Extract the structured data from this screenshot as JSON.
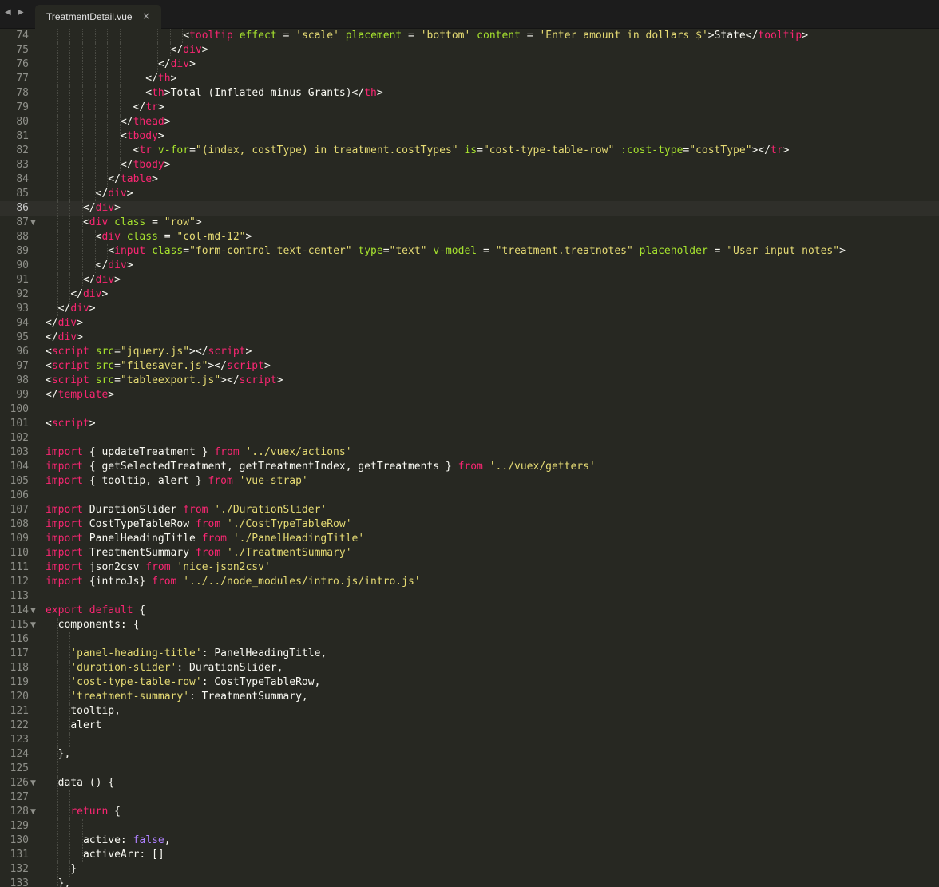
{
  "tabbar": {
    "nav_back": "◀",
    "nav_forward": "▶",
    "tab_title": "TreatmentDetail.vue",
    "tab_close": "×"
  },
  "editor": {
    "current_line": 86,
    "lines": [
      {
        "n": "74",
        "indent": 11,
        "tokens": [
          [
            "p",
            "<"
          ],
          [
            "k",
            "tooltip"
          ],
          [
            "p",
            " "
          ],
          [
            "a",
            "effect"
          ],
          [
            "p",
            " = "
          ],
          [
            "s",
            "'scale'"
          ],
          [
            "p",
            " "
          ],
          [
            "a",
            "placement"
          ],
          [
            "p",
            " = "
          ],
          [
            "s",
            "'bottom'"
          ],
          [
            "p",
            " "
          ],
          [
            "a",
            "content"
          ],
          [
            "p",
            " = "
          ],
          [
            "s",
            "'Enter amount in dollars $'"
          ],
          [
            "p",
            ">State</"
          ],
          [
            "k",
            "tooltip"
          ],
          [
            "p",
            ">"
          ]
        ]
      },
      {
        "n": "75",
        "indent": 10,
        "tokens": [
          [
            "p",
            "</"
          ],
          [
            "k",
            "div"
          ],
          [
            "p",
            ">"
          ]
        ]
      },
      {
        "n": "76",
        "indent": 9,
        "tokens": [
          [
            "p",
            "</"
          ],
          [
            "k",
            "div"
          ],
          [
            "p",
            ">"
          ]
        ]
      },
      {
        "n": "77",
        "indent": 8,
        "tokens": [
          [
            "p",
            "</"
          ],
          [
            "k",
            "th"
          ],
          [
            "p",
            ">"
          ]
        ]
      },
      {
        "n": "78",
        "indent": 8,
        "tokens": [
          [
            "p",
            "<"
          ],
          [
            "k",
            "th"
          ],
          [
            "p",
            ">Total (Inflated minus Grants)</"
          ],
          [
            "k",
            "th"
          ],
          [
            "p",
            ">"
          ]
        ]
      },
      {
        "n": "79",
        "indent": 7,
        "tokens": [
          [
            "p",
            "</"
          ],
          [
            "k",
            "tr"
          ],
          [
            "p",
            ">"
          ]
        ]
      },
      {
        "n": "80",
        "indent": 6,
        "tokens": [
          [
            "p",
            "</"
          ],
          [
            "k",
            "thead"
          ],
          [
            "p",
            ">"
          ]
        ]
      },
      {
        "n": "81",
        "indent": 6,
        "tokens": [
          [
            "p",
            "<"
          ],
          [
            "k",
            "tbody"
          ],
          [
            "p",
            ">"
          ]
        ]
      },
      {
        "n": "82",
        "indent": 7,
        "tokens": [
          [
            "p",
            "<"
          ],
          [
            "k",
            "tr"
          ],
          [
            "p",
            " "
          ],
          [
            "a",
            "v-for"
          ],
          [
            "p",
            "="
          ],
          [
            "s",
            "\"(index, costType) in treatment.costTypes\""
          ],
          [
            "p",
            " "
          ],
          [
            "a",
            "is"
          ],
          [
            "p",
            "="
          ],
          [
            "s",
            "\"cost-type-table-row\""
          ],
          [
            "p",
            " "
          ],
          [
            "a",
            ":cost-type"
          ],
          [
            "p",
            "="
          ],
          [
            "s",
            "\"costType\""
          ],
          [
            "p",
            "></"
          ],
          [
            "k",
            "tr"
          ],
          [
            "p",
            ">"
          ]
        ]
      },
      {
        "n": "83",
        "indent": 6,
        "tokens": [
          [
            "p",
            "</"
          ],
          [
            "k",
            "tbody"
          ],
          [
            "p",
            ">"
          ]
        ]
      },
      {
        "n": "84",
        "indent": 5,
        "tokens": [
          [
            "p",
            "</"
          ],
          [
            "k",
            "table"
          ],
          [
            "p",
            ">"
          ]
        ]
      },
      {
        "n": "85",
        "indent": 4,
        "tokens": [
          [
            "p",
            "</"
          ],
          [
            "k",
            "div"
          ],
          [
            "p",
            ">"
          ]
        ]
      },
      {
        "n": "86",
        "indent": 3,
        "tokens": [
          [
            "p",
            "</"
          ],
          [
            "k",
            "div"
          ],
          [
            "p",
            ">"
          ]
        ]
      },
      {
        "n": "87",
        "indent": 3,
        "fold": true,
        "tokens": [
          [
            "p",
            "<"
          ],
          [
            "k",
            "div"
          ],
          [
            "p",
            " "
          ],
          [
            "a",
            "class"
          ],
          [
            "p",
            " = "
          ],
          [
            "s",
            "\"row\""
          ],
          [
            "p",
            ">"
          ]
        ]
      },
      {
        "n": "88",
        "indent": 4,
        "tokens": [
          [
            "p",
            "<"
          ],
          [
            "k",
            "div"
          ],
          [
            "p",
            " "
          ],
          [
            "a",
            "class"
          ],
          [
            "p",
            " = "
          ],
          [
            "s",
            "\"col-md-12\""
          ],
          [
            "p",
            ">"
          ]
        ]
      },
      {
        "n": "89",
        "indent": 5,
        "tokens": [
          [
            "p",
            "<"
          ],
          [
            "k",
            "input"
          ],
          [
            "p",
            " "
          ],
          [
            "a",
            "class"
          ],
          [
            "p",
            "="
          ],
          [
            "s",
            "\"form-control text-center\""
          ],
          [
            "p",
            " "
          ],
          [
            "a",
            "type"
          ],
          [
            "p",
            "="
          ],
          [
            "s",
            "\"text\""
          ],
          [
            "p",
            " "
          ],
          [
            "a",
            "v-model"
          ],
          [
            "p",
            " = "
          ],
          [
            "s",
            "\"treatment.treatnotes\""
          ],
          [
            "p",
            " "
          ],
          [
            "a",
            "placeholder"
          ],
          [
            "p",
            " = "
          ],
          [
            "s",
            "\"User input notes\""
          ],
          [
            "p",
            ">"
          ]
        ]
      },
      {
        "n": "90",
        "indent": 4,
        "tokens": [
          [
            "p",
            "</"
          ],
          [
            "k",
            "div"
          ],
          [
            "p",
            ">"
          ]
        ]
      },
      {
        "n": "91",
        "indent": 3,
        "tokens": [
          [
            "p",
            "</"
          ],
          [
            "k",
            "div"
          ],
          [
            "p",
            ">"
          ]
        ]
      },
      {
        "n": "92",
        "indent": 2,
        "tokens": [
          [
            "p",
            "</"
          ],
          [
            "k",
            "div"
          ],
          [
            "p",
            ">"
          ]
        ]
      },
      {
        "n": "93",
        "indent": 1,
        "tokens": [
          [
            "p",
            "</"
          ],
          [
            "k",
            "div"
          ],
          [
            "p",
            ">"
          ]
        ]
      },
      {
        "n": "94",
        "indent": 0,
        "tokens": [
          [
            "p",
            "</"
          ],
          [
            "k",
            "div"
          ],
          [
            "p",
            ">"
          ]
        ]
      },
      {
        "n": "95",
        "indent": 0,
        "tokens": [
          [
            "p",
            "</"
          ],
          [
            "k",
            "div"
          ],
          [
            "p",
            ">"
          ]
        ]
      },
      {
        "n": "96",
        "indent": 0,
        "tokens": [
          [
            "p",
            "<"
          ],
          [
            "k",
            "script"
          ],
          [
            "p",
            " "
          ],
          [
            "a",
            "src"
          ],
          [
            "p",
            "="
          ],
          [
            "s",
            "\"jquery.js\""
          ],
          [
            "p",
            "></"
          ],
          [
            "k",
            "script"
          ],
          [
            "p",
            ">"
          ]
        ]
      },
      {
        "n": "97",
        "indent": 0,
        "tokens": [
          [
            "p",
            "<"
          ],
          [
            "k",
            "script"
          ],
          [
            "p",
            " "
          ],
          [
            "a",
            "src"
          ],
          [
            "p",
            "="
          ],
          [
            "s",
            "\"filesaver.js\""
          ],
          [
            "p",
            "></"
          ],
          [
            "k",
            "script"
          ],
          [
            "p",
            ">"
          ]
        ]
      },
      {
        "n": "98",
        "indent": 0,
        "tokens": [
          [
            "p",
            "<"
          ],
          [
            "k",
            "script"
          ],
          [
            "p",
            " "
          ],
          [
            "a",
            "src"
          ],
          [
            "p",
            "="
          ],
          [
            "s",
            "\"tableexport.js\""
          ],
          [
            "p",
            "></"
          ],
          [
            "k",
            "script"
          ],
          [
            "p",
            ">"
          ]
        ]
      },
      {
        "n": "99",
        "indent": 0,
        "tokens": [
          [
            "p",
            "</"
          ],
          [
            "k",
            "template"
          ],
          [
            "p",
            ">"
          ]
        ]
      },
      {
        "n": "100",
        "indent": 0,
        "tokens": []
      },
      {
        "n": "101",
        "indent": 0,
        "tokens": [
          [
            "p",
            "<"
          ],
          [
            "k",
            "script"
          ],
          [
            "p",
            ">"
          ]
        ]
      },
      {
        "n": "102",
        "indent": 0,
        "tokens": []
      },
      {
        "n": "103",
        "indent": 0,
        "tokens": [
          [
            "k",
            "import"
          ],
          [
            "p",
            " { updateTreatment } "
          ],
          [
            "k",
            "from"
          ],
          [
            "p",
            " "
          ],
          [
            "s",
            "'../vuex/actions'"
          ]
        ]
      },
      {
        "n": "104",
        "indent": 0,
        "tokens": [
          [
            "k",
            "import"
          ],
          [
            "p",
            " { getSelectedTreatment, getTreatmentIndex, getTreatments } "
          ],
          [
            "k",
            "from"
          ],
          [
            "p",
            " "
          ],
          [
            "s",
            "'../vuex/getters'"
          ]
        ]
      },
      {
        "n": "105",
        "indent": 0,
        "tokens": [
          [
            "k",
            "import"
          ],
          [
            "p",
            " { tooltip, alert } "
          ],
          [
            "k",
            "from"
          ],
          [
            "p",
            " "
          ],
          [
            "s",
            "'vue-strap'"
          ]
        ]
      },
      {
        "n": "106",
        "indent": 0,
        "tokens": []
      },
      {
        "n": "107",
        "indent": 0,
        "tokens": [
          [
            "k",
            "import"
          ],
          [
            "p",
            " DurationSlider "
          ],
          [
            "k",
            "from"
          ],
          [
            "p",
            " "
          ],
          [
            "s",
            "'./DurationSlider'"
          ]
        ]
      },
      {
        "n": "108",
        "indent": 0,
        "tokens": [
          [
            "k",
            "import"
          ],
          [
            "p",
            " CostTypeTableRow "
          ],
          [
            "k",
            "from"
          ],
          [
            "p",
            " "
          ],
          [
            "s",
            "'./CostTypeTableRow'"
          ]
        ]
      },
      {
        "n": "109",
        "indent": 0,
        "tokens": [
          [
            "k",
            "import"
          ],
          [
            "p",
            " PanelHeadingTitle "
          ],
          [
            "k",
            "from"
          ],
          [
            "p",
            " "
          ],
          [
            "s",
            "'./PanelHeadingTitle'"
          ]
        ]
      },
      {
        "n": "110",
        "indent": 0,
        "tokens": [
          [
            "k",
            "import"
          ],
          [
            "p",
            " TreatmentSummary "
          ],
          [
            "k",
            "from"
          ],
          [
            "p",
            " "
          ],
          [
            "s",
            "'./TreatmentSummary'"
          ]
        ]
      },
      {
        "n": "111",
        "indent": 0,
        "tokens": [
          [
            "k",
            "import"
          ],
          [
            "p",
            " json2csv "
          ],
          [
            "k",
            "from"
          ],
          [
            "p",
            " "
          ],
          [
            "s",
            "'nice-json2csv'"
          ]
        ]
      },
      {
        "n": "112",
        "indent": 0,
        "tokens": [
          [
            "k",
            "import"
          ],
          [
            "p",
            " {introJs} "
          ],
          [
            "k",
            "from"
          ],
          [
            "p",
            " "
          ],
          [
            "s",
            "'../../node_modules/intro.js/intro.js'"
          ]
        ]
      },
      {
        "n": "113",
        "indent": 0,
        "tokens": []
      },
      {
        "n": "114",
        "indent": 0,
        "fold": true,
        "tokens": [
          [
            "k",
            "export"
          ],
          [
            "p",
            " "
          ],
          [
            "k",
            "default"
          ],
          [
            "p",
            " {"
          ]
        ]
      },
      {
        "n": "115",
        "indent": 1,
        "fold": true,
        "tokens": [
          [
            "p",
            "components: {"
          ]
        ]
      },
      {
        "n": "116",
        "indent": 2,
        "tokens": []
      },
      {
        "n": "117",
        "indent": 2,
        "tokens": [
          [
            "s",
            "'panel-heading-title'"
          ],
          [
            "p",
            ": PanelHeadingTitle,"
          ]
        ]
      },
      {
        "n": "118",
        "indent": 2,
        "tokens": [
          [
            "s",
            "'duration-slider'"
          ],
          [
            "p",
            ": DurationSlider,"
          ]
        ]
      },
      {
        "n": "119",
        "indent": 2,
        "tokens": [
          [
            "s",
            "'cost-type-table-row'"
          ],
          [
            "p",
            ": CostTypeTableRow,"
          ]
        ]
      },
      {
        "n": "120",
        "indent": 2,
        "tokens": [
          [
            "s",
            "'treatment-summary'"
          ],
          [
            "p",
            ": TreatmentSummary,"
          ]
        ]
      },
      {
        "n": "121",
        "indent": 2,
        "tokens": [
          [
            "p",
            "tooltip,"
          ]
        ]
      },
      {
        "n": "122",
        "indent": 2,
        "tokens": [
          [
            "p",
            "alert"
          ]
        ]
      },
      {
        "n": "123",
        "indent": 2,
        "tokens": []
      },
      {
        "n": "124",
        "indent": 1,
        "tokens": [
          [
            "p",
            "},"
          ]
        ]
      },
      {
        "n": "125",
        "indent": 1,
        "tokens": []
      },
      {
        "n": "126",
        "indent": 1,
        "fold": true,
        "tokens": [
          [
            "p",
            "data () {"
          ]
        ]
      },
      {
        "n": "127",
        "indent": 2,
        "tokens": []
      },
      {
        "n": "128",
        "indent": 2,
        "fold": true,
        "tokens": [
          [
            "k",
            "return"
          ],
          [
            "p",
            " {"
          ]
        ]
      },
      {
        "n": "129",
        "indent": 3,
        "tokens": []
      },
      {
        "n": "130",
        "indent": 3,
        "tokens": [
          [
            "p",
            "active: "
          ],
          [
            "q",
            "false"
          ],
          [
            "p",
            ","
          ]
        ]
      },
      {
        "n": "131",
        "indent": 3,
        "tokens": [
          [
            "p",
            "activeArr: []"
          ]
        ]
      },
      {
        "n": "132",
        "indent": 2,
        "tokens": [
          [
            "p",
            "}"
          ]
        ]
      },
      {
        "n": "133",
        "indent": 1,
        "tokens": [
          [
            "p",
            "},"
          ]
        ]
      }
    ]
  },
  "colors": {
    "background": "#272822",
    "keyword": "#f92672",
    "string": "#e6db74",
    "attribute": "#a6e22e",
    "constant": "#ae81ff",
    "plain": "#f8f8f2",
    "gutter_text": "#8f908a"
  },
  "icons": {
    "nav_back": "triangle-left-icon",
    "nav_forward": "triangle-right-icon",
    "fold": "fold-arrow-down-icon",
    "tab_close": "close-icon"
  }
}
